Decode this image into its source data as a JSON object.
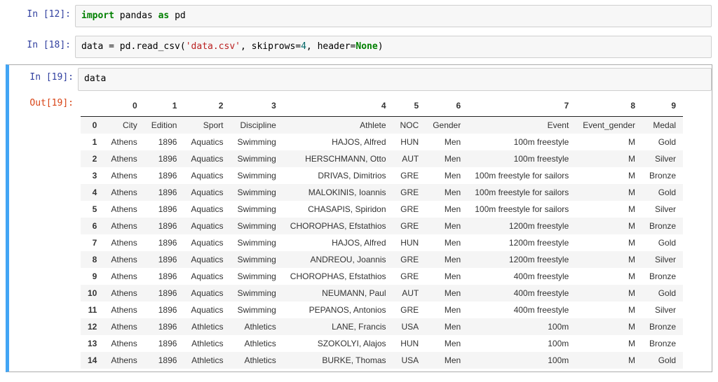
{
  "cells": [
    {
      "type": "in",
      "prompt": "In [12]:",
      "code_html": "<span class='tok-kw'>import</span> pandas <span class='tok-kw'>as</span> pd"
    },
    {
      "type": "in",
      "prompt": "In [18]:",
      "code_html": "data = pd.read_csv(<span class='tok-str'>'data.csv'</span>, skiprows=<span class='tok-num'>4</span>, header=<span class='tok-kw'>None</span>)"
    }
  ],
  "selected": {
    "in_prompt": "In [19]:",
    "code_html": "data",
    "out_prompt": "Out[19]:"
  },
  "dataframe": {
    "columns": [
      "0",
      "1",
      "2",
      "3",
      "4",
      "5",
      "6",
      "7",
      "8",
      "9"
    ],
    "rows": [
      {
        "idx": "0",
        "cells": [
          "City",
          "Edition",
          "Sport",
          "Discipline",
          "Athlete",
          "NOC",
          "Gender",
          "Event",
          "Event_gender",
          "Medal"
        ]
      },
      {
        "idx": "1",
        "cells": [
          "Athens",
          "1896",
          "Aquatics",
          "Swimming",
          "HAJOS, Alfred",
          "HUN",
          "Men",
          "100m freestyle",
          "M",
          "Gold"
        ]
      },
      {
        "idx": "2",
        "cells": [
          "Athens",
          "1896",
          "Aquatics",
          "Swimming",
          "HERSCHMANN, Otto",
          "AUT",
          "Men",
          "100m freestyle",
          "M",
          "Silver"
        ]
      },
      {
        "idx": "3",
        "cells": [
          "Athens",
          "1896",
          "Aquatics",
          "Swimming",
          "DRIVAS, Dimitrios",
          "GRE",
          "Men",
          "100m freestyle for sailors",
          "M",
          "Bronze"
        ]
      },
      {
        "idx": "4",
        "cells": [
          "Athens",
          "1896",
          "Aquatics",
          "Swimming",
          "MALOKINIS, Ioannis",
          "GRE",
          "Men",
          "100m freestyle for sailors",
          "M",
          "Gold"
        ]
      },
      {
        "idx": "5",
        "cells": [
          "Athens",
          "1896",
          "Aquatics",
          "Swimming",
          "CHASAPIS, Spiridon",
          "GRE",
          "Men",
          "100m freestyle for sailors",
          "M",
          "Silver"
        ]
      },
      {
        "idx": "6",
        "cells": [
          "Athens",
          "1896",
          "Aquatics",
          "Swimming",
          "CHOROPHAS, Efstathios",
          "GRE",
          "Men",
          "1200m freestyle",
          "M",
          "Bronze"
        ]
      },
      {
        "idx": "7",
        "cells": [
          "Athens",
          "1896",
          "Aquatics",
          "Swimming",
          "HAJOS, Alfred",
          "HUN",
          "Men",
          "1200m freestyle",
          "M",
          "Gold"
        ]
      },
      {
        "idx": "8",
        "cells": [
          "Athens",
          "1896",
          "Aquatics",
          "Swimming",
          "ANDREOU, Joannis",
          "GRE",
          "Men",
          "1200m freestyle",
          "M",
          "Silver"
        ]
      },
      {
        "idx": "9",
        "cells": [
          "Athens",
          "1896",
          "Aquatics",
          "Swimming",
          "CHOROPHAS, Efstathios",
          "GRE",
          "Men",
          "400m freestyle",
          "M",
          "Bronze"
        ]
      },
      {
        "idx": "10",
        "cells": [
          "Athens",
          "1896",
          "Aquatics",
          "Swimming",
          "NEUMANN, Paul",
          "AUT",
          "Men",
          "400m freestyle",
          "M",
          "Gold"
        ]
      },
      {
        "idx": "11",
        "cells": [
          "Athens",
          "1896",
          "Aquatics",
          "Swimming",
          "PEPANOS, Antonios",
          "GRE",
          "Men",
          "400m freestyle",
          "M",
          "Silver"
        ]
      },
      {
        "idx": "12",
        "cells": [
          "Athens",
          "1896",
          "Athletics",
          "Athletics",
          "LANE, Francis",
          "USA",
          "Men",
          "100m",
          "M",
          "Bronze"
        ]
      },
      {
        "idx": "13",
        "cells": [
          "Athens",
          "1896",
          "Athletics",
          "Athletics",
          "SZOKOLYI, Alajos",
          "HUN",
          "Men",
          "100m",
          "M",
          "Bronze"
        ]
      },
      {
        "idx": "14",
        "cells": [
          "Athens",
          "1896",
          "Athletics",
          "Athletics",
          "BURKE, Thomas",
          "USA",
          "Men",
          "100m",
          "M",
          "Gold"
        ]
      }
    ]
  }
}
